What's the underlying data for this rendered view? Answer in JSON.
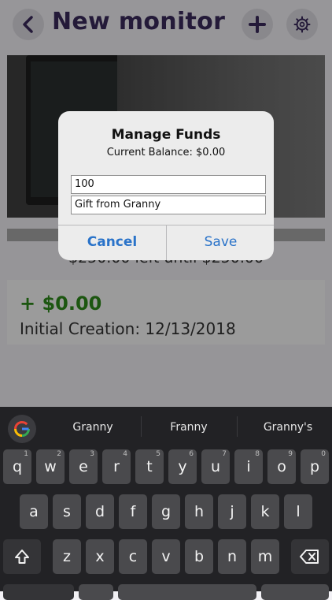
{
  "header": {
    "title": "New monitor"
  },
  "monitor": {
    "left_until": "$250.00 left until $250.00",
    "amount": "+ $0.00",
    "created": "Initial Creation: 12/13/2018"
  },
  "alert": {
    "title": "Manage Funds",
    "message": "Current Balance: $0.00",
    "amount_value": "100",
    "note_value": "Gift from Granny",
    "cancel_label": "Cancel",
    "save_label": "Save"
  },
  "keyboard": {
    "suggestions": [
      "Granny",
      "Franny",
      "Granny's"
    ],
    "row1": [
      "q",
      "w",
      "e",
      "r",
      "t",
      "y",
      "u",
      "i",
      "o",
      "p"
    ],
    "row1_hints": [
      "1",
      "2",
      "3",
      "4",
      "5",
      "6",
      "7",
      "8",
      "9",
      "0"
    ],
    "row2": [
      "a",
      "s",
      "d",
      "f",
      "g",
      "h",
      "j",
      "k",
      "l"
    ],
    "row3": [
      "z",
      "x",
      "c",
      "v",
      "b",
      "n",
      "m"
    ]
  },
  "colors": {
    "accent": "#3a2a5c",
    "positive": "#2e8b1a",
    "link": "#2a73c9"
  }
}
